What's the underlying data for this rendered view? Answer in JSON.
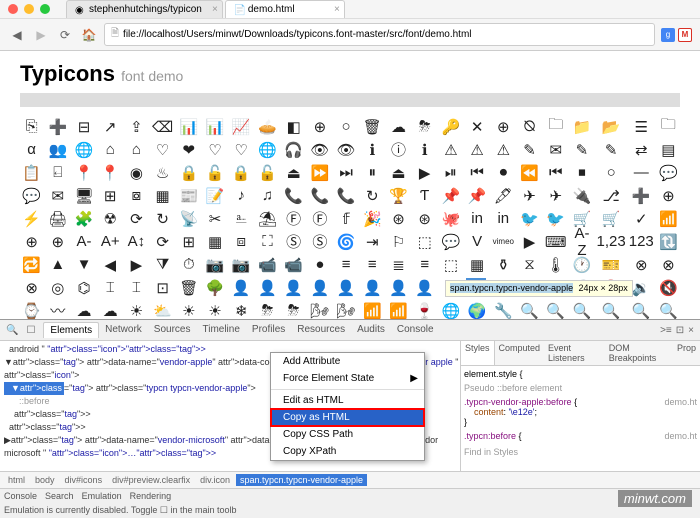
{
  "browser": {
    "tabs": [
      {
        "title": "stephenhutchings/typicon",
        "icon": "github"
      },
      {
        "title": "demo.html",
        "icon": "file"
      }
    ],
    "url": "file://localhost/Users/minwt/Downloads/typicons.font-master/src/font/demo.html"
  },
  "page": {
    "title_bold": "Typicons",
    "title_light": "font demo"
  },
  "tooltip": {
    "text": "span.typcn.typcn-vendor-apple",
    "dims": "24px × 28px"
  },
  "devtools": {
    "main_tabs": [
      "Elements",
      "Network",
      "Sources",
      "Timeline",
      "Profiles",
      "Resources",
      "Audits",
      "Console"
    ],
    "active_main_tab": "Elements",
    "side_tabs": [
      "Styles",
      "Computed",
      "Event Listeners",
      "DOM Breakpoints",
      "Prop"
    ],
    "active_side_tab": "Styles",
    "code_lines": [
      "  android \" class=\"icon\"></div>",
      "▼<div data-name=\"vendor-apple\" data-code=\"0xe12e\" data-match=\" vendor apple \"",
      "class=\"icon\">",
      "  ▼<span class=\"typcn typcn-vendor-apple\">",
      "      ::before",
      "    </span>",
      "  </div>",
      "▶<div data-name=\"vendor-microsoft\" data-code=\"0xe12f\" data-match=\" vendor",
      "microsoft \" class=\"icon\">…</div>"
    ],
    "selected_line_index": 3,
    "styles": {
      "element_style": "element.style {",
      "pseudo": "Pseudo ::before element",
      "rule1_sel": ".typcn-vendor-apple:before",
      "rule1_src": "demo.ht",
      "rule1_prop": "content",
      "rule1_val": "'\\e12e'",
      "rule2_sel": ".typcn:before",
      "rule2_src": "demo.ht",
      "find": "Find in Styles"
    },
    "breadcrumb": [
      "html",
      "body",
      "div#icons",
      "div#preview.clearfix",
      "div.icon",
      "span.typcn.typcn-vendor-apple"
    ],
    "footer_tabs": [
      "Console",
      "Search",
      "Emulation",
      "Rendering"
    ],
    "status": "Emulation is currently disabled. Toggle ☐ in the main toolb"
  },
  "context_menu": {
    "items": [
      "Add Attribute",
      "Force Element State",
      "Edit as HTML",
      "Copy as HTML",
      "Copy CSS Path",
      "Copy XPath"
    ],
    "highlighted": "Copy as HTML"
  },
  "watermark": "minwt.com"
}
